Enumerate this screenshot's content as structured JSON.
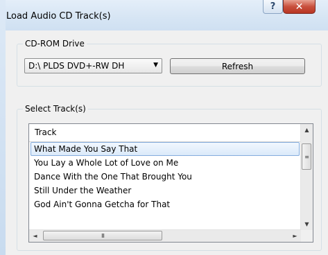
{
  "window": {
    "title": "Load Audio CD Track(s)",
    "help_glyph": "?",
    "close_glyph": "✕"
  },
  "cd_rom": {
    "group_label": "CD-ROM Drive",
    "drive_value": "D:\\ PLDS    DVD+-RW DH",
    "dropdown_glyph": "▼",
    "refresh_label": "Refresh"
  },
  "tracks": {
    "group_label": "Select Track(s)",
    "column_header": "Track",
    "items": [
      "What Made You Say That",
      "You Lay a Whole Lot of Love on Me",
      "Dance With the One That Brought You",
      "Still Under the Weather",
      "God Ain't Gonna Getcha for That"
    ],
    "selected_index": 0,
    "scroll": {
      "up": "▲",
      "down": "▼",
      "left": "◄",
      "right": "►",
      "thumb_grip": "≡",
      "hthumb_grip": "III"
    }
  }
}
